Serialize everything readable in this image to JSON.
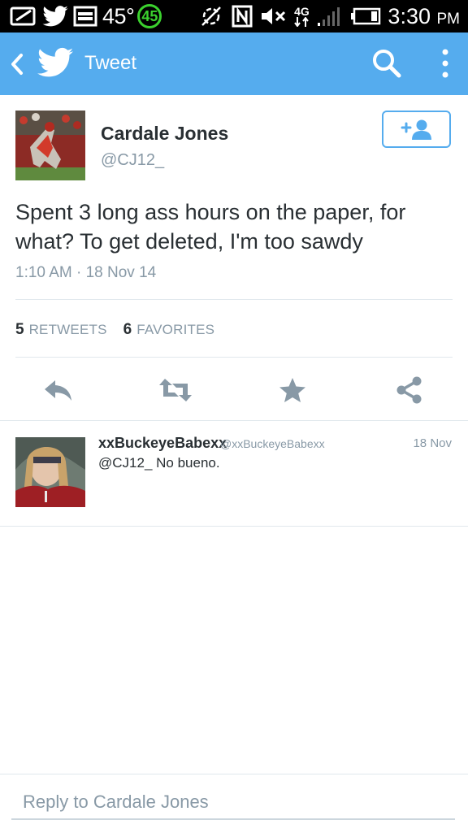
{
  "status_bar": {
    "temperature": "45°",
    "notification_count": "45",
    "network": "4G",
    "time": "3:30",
    "time_suffix": "PM"
  },
  "app_bar": {
    "title": "Tweet",
    "color": "#55acee"
  },
  "tweet": {
    "author_name": "Cardale Jones",
    "author_handle": "@CJ12_",
    "text": "Spent 3 long ass hours on the paper, for what? To get deleted, I'm too sawdy",
    "timestamp": "1:10 AM · 18 Nov 14",
    "retweets": {
      "count": "5",
      "label": "RETWEETS"
    },
    "favorites": {
      "count": "6",
      "label": "FAVORITES"
    },
    "actions": [
      "reply-icon",
      "retweet-icon",
      "favorite-icon",
      "share-icon"
    ],
    "follow_icon": "add-user-icon"
  },
  "reply": {
    "name": "xxBuckeyeBabexx",
    "handle": "@xxBuckeyeBabexx",
    "date": "18 Nov",
    "text": "@CJ12_ No bueno."
  },
  "reply_box": {
    "placeholder": "Reply to Cardale Jones"
  }
}
